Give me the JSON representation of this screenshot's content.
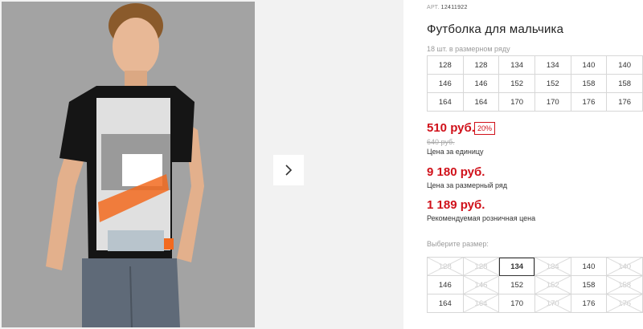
{
  "article": {
    "label": "АРТ.",
    "number": "12411922"
  },
  "product_title": "Футболка для мальчика",
  "pack_note": "18 шт. в размерном ряду",
  "size_row": [
    [
      "128",
      "128",
      "134",
      "134",
      "140",
      "140"
    ],
    [
      "146",
      "146",
      "152",
      "152",
      "158",
      "158"
    ],
    [
      "164",
      "164",
      "170",
      "170",
      "176",
      "176"
    ]
  ],
  "price": {
    "current": "510 руб.",
    "discount": "20%",
    "old": "640 руб.",
    "unit_label": "Цена за единицу"
  },
  "pack_price": {
    "value": "9 180 руб.",
    "label": "Цена за размерный ряд"
  },
  "retail_price": {
    "value": "1 189 руб.",
    "label": "Рекомендуемая розничная цена"
  },
  "choose_label": "Выберите размер:",
  "choose_sizes": [
    [
      {
        "v": "128",
        "s": "na"
      },
      {
        "v": "128",
        "s": "na"
      },
      {
        "v": "134",
        "s": "sel"
      },
      {
        "v": "134",
        "s": "na"
      },
      {
        "v": "140",
        "s": "av"
      },
      {
        "v": "140",
        "s": "na"
      }
    ],
    [
      {
        "v": "146",
        "s": "av"
      },
      {
        "v": "146",
        "s": "na"
      },
      {
        "v": "152",
        "s": "av"
      },
      {
        "v": "152",
        "s": "na"
      },
      {
        "v": "158",
        "s": "av"
      },
      {
        "v": "158",
        "s": "na"
      }
    ],
    [
      {
        "v": "164",
        "s": "av"
      },
      {
        "v": "164",
        "s": "na"
      },
      {
        "v": "170",
        "s": "av"
      },
      {
        "v": "170",
        "s": "na"
      },
      {
        "v": "176",
        "s": "av"
      },
      {
        "v": "176",
        "s": "na"
      }
    ]
  ],
  "colors": {
    "accent": "#d0111a"
  }
}
